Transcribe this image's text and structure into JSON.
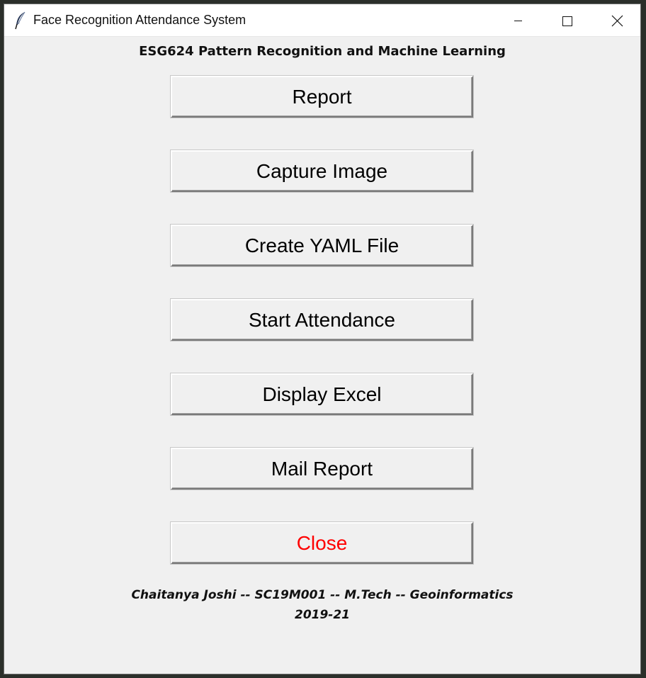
{
  "window": {
    "title": "Face Recognition Attendance System",
    "icon": "feather-icon",
    "controls": [
      "minimize-icon",
      "maximize-icon",
      "close-icon"
    ]
  },
  "header": {
    "course_title": "ESG624 Pattern Recognition and Machine Learning"
  },
  "buttons": [
    {
      "id": "report",
      "label": "Report"
    },
    {
      "id": "capture-image",
      "label": "Capture Image"
    },
    {
      "id": "create-yaml-file",
      "label": "Create YAML File"
    },
    {
      "id": "start-attendance",
      "label": "Start Attendance"
    },
    {
      "id": "display-excel",
      "label": "Display Excel"
    },
    {
      "id": "mail-report",
      "label": "Mail Report"
    },
    {
      "id": "close",
      "label": "Close",
      "color": "#ff0000"
    }
  ],
  "footer": {
    "credit": "Chaitanya Joshi -- SC19M001 -- M.Tech -- Geoinformatics",
    "years": "2019-21"
  },
  "colors": {
    "window_background": "#f0f0f0",
    "titlebar_background": "#ffffff",
    "close_label": "#ff0000"
  }
}
